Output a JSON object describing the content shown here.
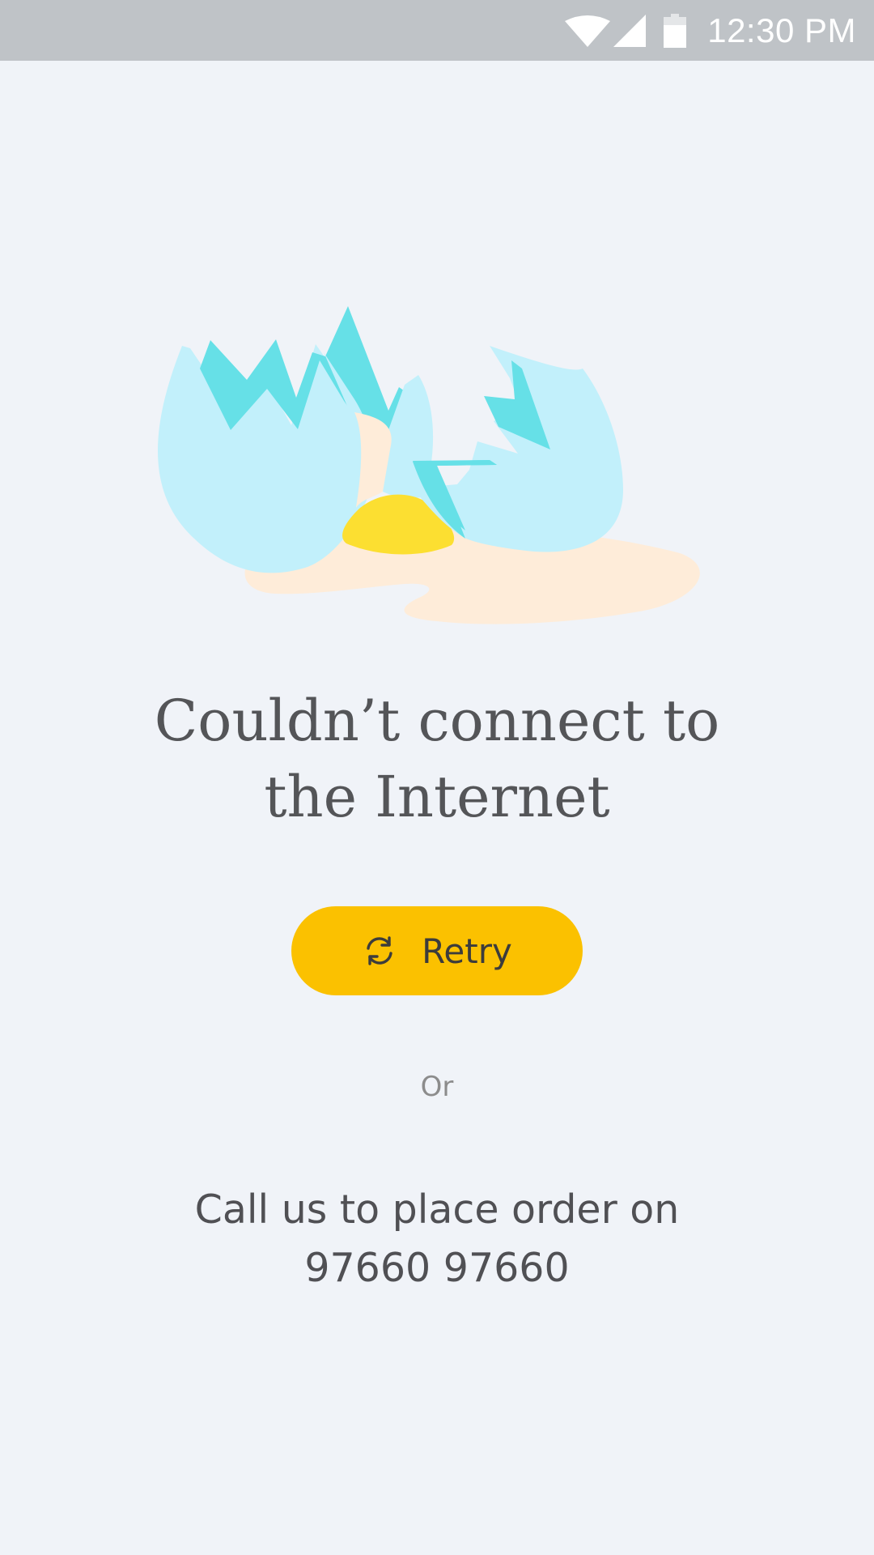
{
  "status_bar": {
    "time": "12:30 PM",
    "icons": [
      "wifi-icon",
      "signal-icon",
      "battery-icon"
    ]
  },
  "illustration": {
    "icon": "broken-egg-icon",
    "colors": {
      "shell_light": "#c2f0fb",
      "shell_dark": "#66e0e7",
      "egg_white": "#feecd9",
      "yolk": "#fcdf31"
    }
  },
  "error": {
    "title_line1": "Couldn’t connect to",
    "title_line2": "the Internet"
  },
  "retry_button": {
    "icon": "refresh-icon",
    "label": "Retry",
    "color": "#fbc100"
  },
  "separator": {
    "text": "Or"
  },
  "call": {
    "line1": "Call us to place order on",
    "phone": "97660 97660"
  }
}
